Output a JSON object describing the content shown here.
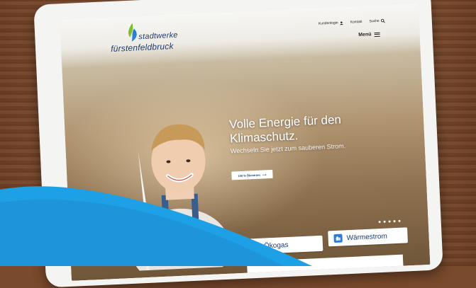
{
  "logo": {
    "line1": "stadtwerke",
    "line2": "fürstenfeldbruck"
  },
  "topnav": {
    "login": "Kundenlogin",
    "contact": "Kontakt",
    "search": "Suche"
  },
  "menu": {
    "label": "Menü"
  },
  "hero": {
    "title": "Volle Energie für den Klimaschutz.",
    "subtitle": "Wechseln Sie jetzt zum sauberen Strom.",
    "cta_label": "100 % Ökostrom"
  },
  "products": [
    {
      "label": "Ökogas",
      "icon": "flame-drop-icon"
    },
    {
      "label": "Wärmestrom",
      "icon": "heat-plug-icon"
    }
  ],
  "carousel": {
    "dot_count": 5
  },
  "colors": {
    "brand_blue": "#1e3c6e",
    "accent_blue": "#2a7fd4",
    "swoosh_blue": "#1da0e6"
  }
}
